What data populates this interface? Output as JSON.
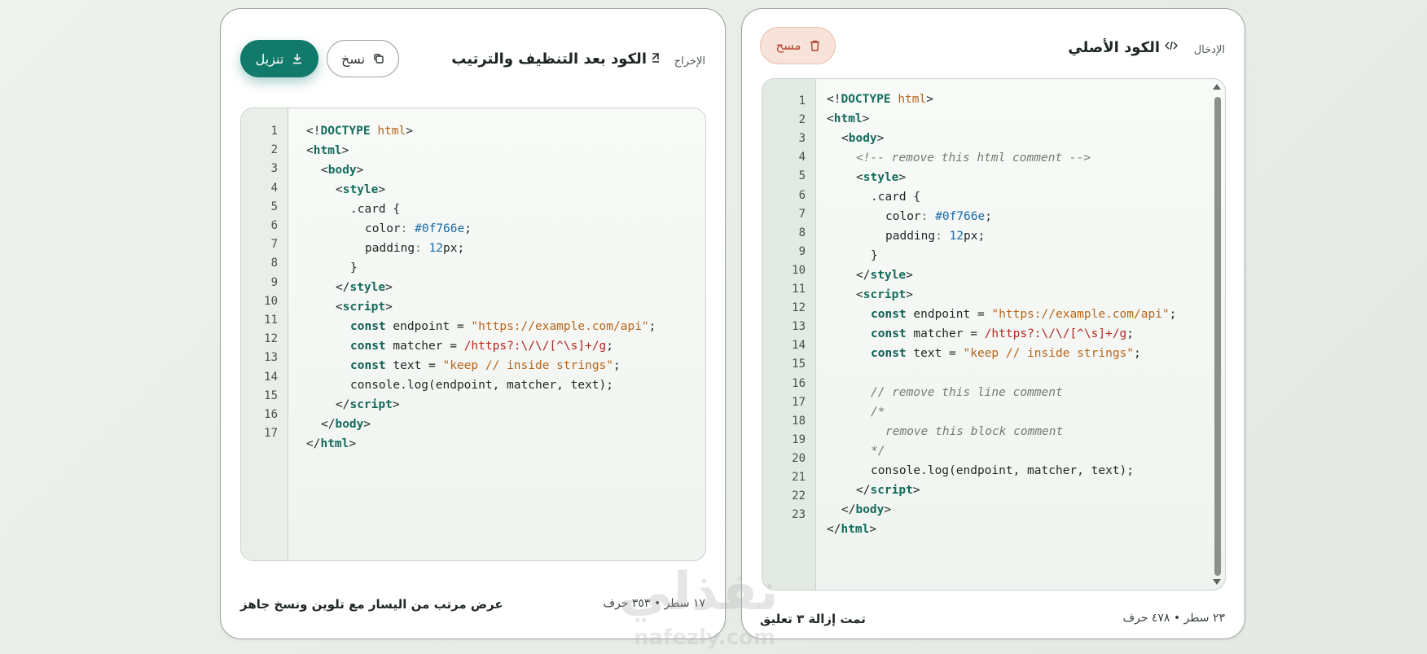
{
  "output_panel": {
    "tag": "الإخراج",
    "tag_icon": "output-arrow-icon",
    "title": "الكود بعد التنظيف والترتيب",
    "download_label": "تنزيل",
    "copy_label": "نسخ",
    "footer_note": "عرض مرتب من اليسار مع تلوين ونسخ جاهز",
    "footer_stats": "١٧ سطر • ٣٥٣ حرف",
    "line_numbers": [
      "1",
      "2",
      "3",
      "4",
      "5",
      "6",
      "7",
      "8",
      "9",
      "10",
      "11",
      "12",
      "13",
      "14",
      "15",
      "16",
      "17"
    ]
  },
  "input_panel": {
    "tag": "الإدخال",
    "tag_icon": "code-icon",
    "title": "الكود الأصلي",
    "clear_label": "مسح",
    "footer_note": "تمت إزالة ٣ تعليق",
    "footer_stats": "٢٣ سطر • ٤٧٨ حرف",
    "line_numbers": [
      "1",
      "2",
      "3",
      "4",
      "5",
      "6",
      "7",
      "8",
      "9",
      "10",
      "11",
      "12",
      "13",
      "14",
      "15",
      "16",
      "17",
      "18",
      "19",
      "20",
      "21",
      "22",
      "23"
    ]
  },
  "code_tokens": {
    "doctype_open": "<!",
    "doctype": "DOCTYPE",
    "html_word": "html",
    "lt": "<",
    "gt": ">",
    "lt_slash": "</",
    "html": "html",
    "body": "body",
    "style": "style",
    "script": "script",
    "card_open": ".card {",
    "color_prop": "color",
    "colon": ":",
    "color_val": "#0f766e",
    "semi": ";",
    "padding_prop": "padding",
    "padding_num": "12",
    "padding_unit": "px;",
    "close_brace": "}",
    "const": "const",
    "endpoint_decl": " endpoint = ",
    "endpoint_val": "\"https://example.com/api\"",
    "matcher_decl": " matcher = ",
    "matcher_val": "/https?:\\/\\/[^\\s]+/g",
    "text_decl": " text = ",
    "text_val": "\"keep // inside strings\"",
    "console_line": "console.log(endpoint, matcher, text);",
    "html_comment": "<!-- remove this html comment -->",
    "line_comment": "// remove this line comment",
    "block_open": "/*",
    "block_body": "remove this block comment",
    "block_close": "*/"
  },
  "watermark": {
    "text": "نفذلي",
    "sub": "nafezly.com"
  }
}
